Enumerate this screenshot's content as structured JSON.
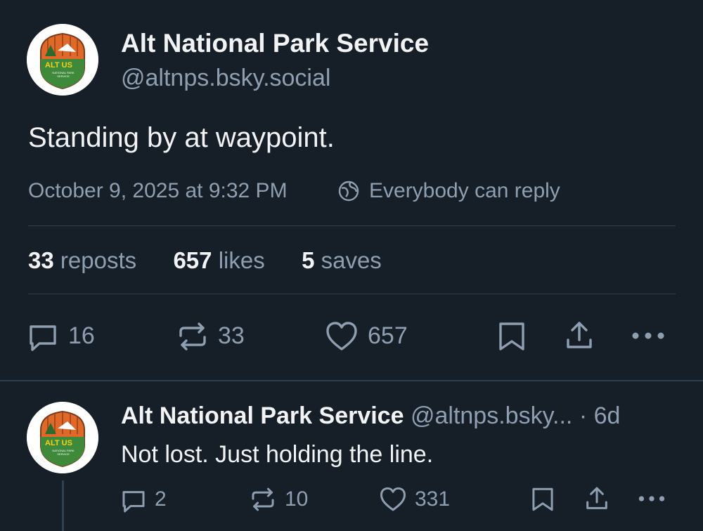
{
  "main_post": {
    "author_name": "Alt National Park Service",
    "handle": "@altnps.bsky.social",
    "text": "Standing by at waypoint.",
    "timestamp": "October 9, 2025 at 9:32 PM",
    "reply_setting": "Everybody can reply",
    "avatar_text": "ALT US",
    "avatar_subtext": "NATIONAL PARK SERVICE",
    "stats": {
      "reposts_count": "33",
      "reposts_label": "reposts",
      "likes_count": "657",
      "likes_label": "likes",
      "saves_count": "5",
      "saves_label": "saves"
    },
    "actions": {
      "reply_count": "16",
      "repost_count": "33",
      "like_count": "657"
    }
  },
  "reply_post": {
    "author_name": "Alt National Park Service",
    "handle": "@altnps.bsky...",
    "age": "· 6d",
    "text": "Not lost. Just holding the line.",
    "avatar_text": "ALT US",
    "avatar_subtext": "NATIONAL PARK SERVICE",
    "actions": {
      "reply_count": "2",
      "repost_count": "10",
      "like_count": "331"
    }
  },
  "icons": {
    "reply": "speech-bubble-icon",
    "repost": "repost-arrows-icon",
    "like": "heart-icon",
    "bookmark": "bookmark-icon",
    "share": "share-upload-icon",
    "more": "ellipsis-icon",
    "reply_setting": "globe-icon"
  },
  "colors": {
    "background": "#161e27",
    "text": "#f1f3f5",
    "muted": "#8f9fb2",
    "divider": "#2e4153",
    "avatar_orange": "#e0692a",
    "avatar_green": "#3f8a3a"
  }
}
